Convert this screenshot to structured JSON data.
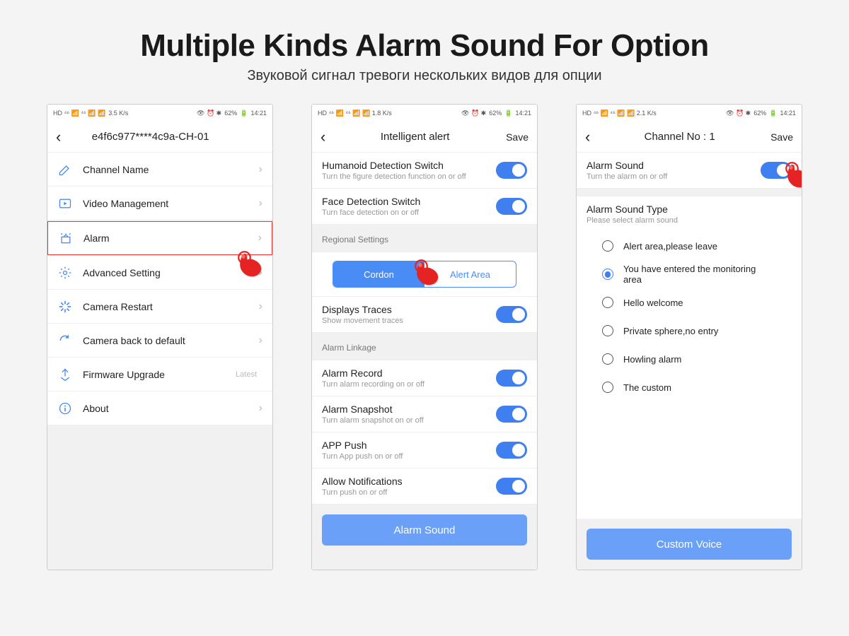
{
  "headline": "Multiple Kinds Alarm Sound For Option",
  "subhead": "Звуковой сигнал тревоги нескольких видов для опции",
  "status": {
    "left": "HD  46 ull 46 ull",
    "speed": "3.5 K/s",
    "right": "62%",
    "time": "14:21"
  },
  "screen1": {
    "title": "e4f6c977****4c9a-CH-01",
    "items": [
      "Channel Name",
      "Video Management",
      "Alarm",
      "Advanced Setting",
      "Camera Restart",
      "Camera back to default",
      "Firmware Upgrade",
      "About"
    ],
    "latest": "Latest"
  },
  "screen2": {
    "title": "Intelligent alert",
    "save": "Save",
    "humanoid_t": "Humanoid Detection Switch",
    "humanoid_s": "Turn the figure detection function on or off",
    "face_t": "Face Detection Switch",
    "face_s": "Turn face detection on or off",
    "region_hdr": "Regional Settings",
    "seg_cordon": "Cordon",
    "seg_alert": "Alert Area",
    "traces_t": "Displays Traces",
    "traces_s": "Show movement traces",
    "linkage_hdr": "Alarm Linkage",
    "rec_t": "Alarm Record",
    "rec_s": "Turn alarm recording on or off",
    "snap_t": "Alarm Snapshot",
    "snap_s": "Turn alarm snapshot on or off",
    "push_t": "APP Push",
    "push_s": "Turn App push on or off",
    "notif_t": "Allow Notifications",
    "notif_s": "Turn push on or off",
    "btn": "Alarm Sound"
  },
  "screen3": {
    "title": "Channel No : 1",
    "save": "Save",
    "as_t": "Alarm Sound",
    "as_s": "Turn the alarm on or off",
    "type_t": "Alarm Sound Type",
    "type_s": "Please select alarm sound",
    "opts": [
      "Alert area,please leave",
      "You have entered the monitoring area",
      "Hello welcome",
      "Private sphere,no entry",
      "Howling alarm",
      "The custom"
    ],
    "btn": "Custom Voice"
  }
}
